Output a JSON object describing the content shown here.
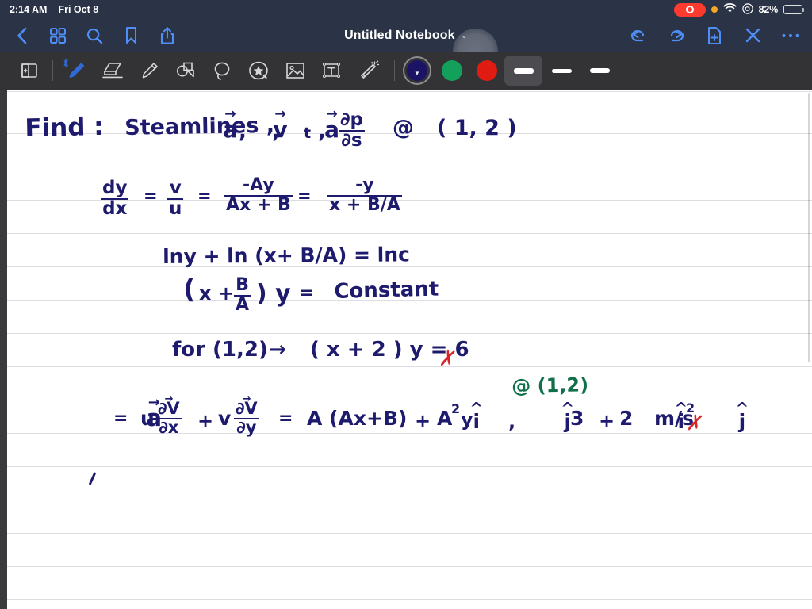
{
  "status_bar": {
    "time": "2:14 AM",
    "date": "Fri Oct 8",
    "battery_percent": "82%",
    "icons": [
      "screen-recording-indicator",
      "orange-privacy-dot",
      "wifi-icon",
      "focus-icon",
      "battery-icon"
    ]
  },
  "nav_bar": {
    "title": "Untitled Notebook",
    "title_chevron": "⌄",
    "left_icons": [
      {
        "name": "back-button",
        "glyph": "back-chevron-icon"
      },
      {
        "name": "page-grid-button",
        "glyph": "grid-icon"
      },
      {
        "name": "search-button",
        "glyph": "search-icon"
      },
      {
        "name": "bookmark-button",
        "glyph": "bookmark-icon"
      },
      {
        "name": "share-button",
        "glyph": "share-icon"
      }
    ],
    "right_icons": [
      {
        "name": "undo-button",
        "glyph": "undo-icon"
      },
      {
        "name": "redo-button",
        "glyph": "redo-icon"
      },
      {
        "name": "new-page-button",
        "glyph": "document-plus-icon"
      },
      {
        "name": "close-button",
        "glyph": "close-icon"
      },
      {
        "name": "more-options-button",
        "glyph": "ellipsis-icon"
      }
    ]
  },
  "toolbar": {
    "tools": [
      {
        "name": "page-layout-tool",
        "label": "Page Layout",
        "active": false
      },
      {
        "name": "pen-tool",
        "label": "Pen",
        "active": true,
        "bluetooth": true
      },
      {
        "name": "eraser-tool",
        "label": "Eraser",
        "active": false
      },
      {
        "name": "highlighter-tool",
        "label": "Highlighter",
        "active": false
      },
      {
        "name": "shapes-tool",
        "label": "Shapes",
        "active": false
      },
      {
        "name": "lasso-tool",
        "label": "Lasso",
        "active": false
      },
      {
        "name": "sticker-tool",
        "label": "Sticker",
        "active": false
      },
      {
        "name": "image-tool",
        "label": "Image",
        "active": false
      },
      {
        "name": "text-tool",
        "label": "Text Box",
        "active": false
      },
      {
        "name": "magic-tool",
        "label": "Magic Wand",
        "active": false
      }
    ],
    "colors": [
      {
        "name": "color-swatch-navy",
        "hex": "#1b1464",
        "selected": true
      },
      {
        "name": "color-swatch-green",
        "hex": "#12a05a",
        "selected": false
      },
      {
        "name": "color-swatch-red",
        "hex": "#e01b12",
        "selected": false
      }
    ],
    "stroke_widths": [
      {
        "name": "stroke-width-thick",
        "thickness": 7,
        "selected": true
      },
      {
        "name": "stroke-width-medium",
        "thickness": 5,
        "selected": false
      },
      {
        "name": "stroke-width-thin",
        "thickness": 6,
        "selected": false
      }
    ]
  },
  "notes": {
    "line_1_label": "Find :",
    "line_1_body": "Steamlines ,",
    "line_1_vars_a": "a",
    "line_1_vars_v": "v",
    "line_1_vars_at": "a",
    "line_1_at_sub": "t",
    "line_1_frac_num": "∂p",
    "line_1_frac_den": "∂s",
    "line_1_at": "@",
    "line_1_point": "( 1, 2 )",
    "line_2_f1_num": "dy",
    "line_2_f1_den": "dx",
    "line_2_eq1": "=",
    "line_2_f2_num": "v",
    "line_2_f2_den": "u",
    "line_2_eq2": "=",
    "line_2_f3_num": "-Ay",
    "line_2_f3_den": "Ax + B",
    "line_2_eq3": "=",
    "line_2_f4_num": "-y",
    "line_2_f4_den": "x + B/A",
    "line_3": "lny + ln (x+ B/A) = lnc",
    "line_4_open": "(",
    "line_4_x": "x +",
    "line_4_num": "B",
    "line_4_den": "A",
    "line_4_close": ") y",
    "line_4_eq": "=",
    "line_4_rhs": "Constant",
    "line_5_for": "for (1,2)",
    "line_5_arrow": "→",
    "line_5_expr": "( x + 2 ) y = 6",
    "line_5_check": "✗",
    "line_6_a": "a",
    "line_6_eq1": "=",
    "line_6_u": "u",
    "line_6_f1_num": "∂V",
    "line_6_f1_den": "∂x",
    "line_6_plus1": "+",
    "line_6_v": "v",
    "line_6_f2_num": "∂V",
    "line_6_f2_den": "∂y",
    "line_6_eq2": "=",
    "line_6_term1": "A (Ax+B)",
    "line_6_ihat": "i",
    "line_6_plus2": "+",
    "line_6_term2": "A",
    "line_6_sup2": "2",
    "line_6_y": "y",
    "line_6_jhat": "j",
    "line_6_comma": ",",
    "line_6_result1": "3",
    "line_6_result_ihat": "i",
    "line_6_plus3": "+",
    "line_6_result2": "2",
    "line_6_result_jhat": "j",
    "line_6_units": "m/s",
    "line_6_units_sup": "2",
    "line_6_check": "✗",
    "annotation_green": "@ (1,2)"
  }
}
